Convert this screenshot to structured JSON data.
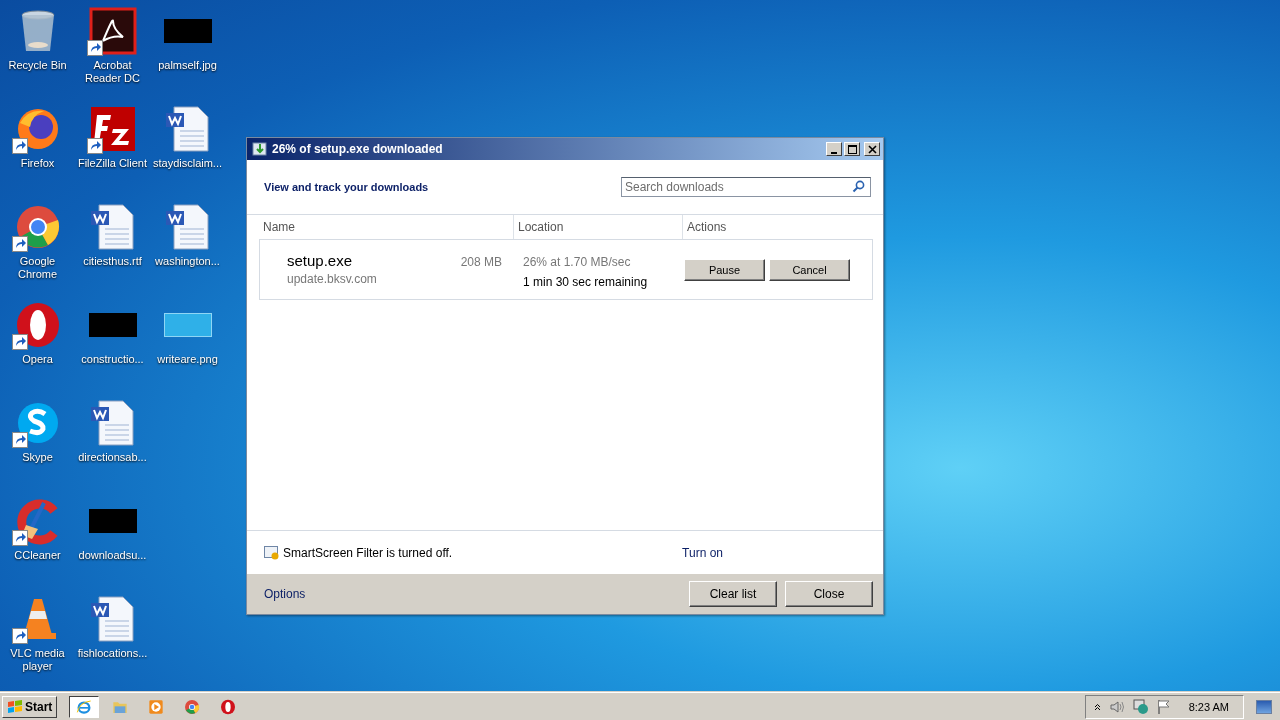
{
  "desktop_icons": [
    {
      "label": "Recycle Bin",
      "kind": "bin",
      "shortcut": false
    },
    {
      "label": "Firefox",
      "kind": "firefox",
      "shortcut": true
    },
    {
      "label": "Google Chrome",
      "kind": "chrome",
      "shortcut": true
    },
    {
      "label": "Opera",
      "kind": "opera",
      "shortcut": true
    },
    {
      "label": "Skype",
      "kind": "skype",
      "shortcut": true
    },
    {
      "label": "CCleaner",
      "kind": "ccleaner",
      "shortcut": true
    },
    {
      "label": "VLC media player",
      "kind": "vlc",
      "shortcut": true
    },
    {
      "label": "Acrobat Reader DC",
      "kind": "acrobat",
      "shortcut": true
    },
    {
      "label": "FileZilla Client",
      "kind": "filezilla",
      "shortcut": true
    },
    {
      "label": "citiesthus.rtf",
      "kind": "document",
      "shortcut": false
    },
    {
      "label": "constructio...",
      "kind": "thumbnail",
      "shortcut": false
    },
    {
      "label": "directionsab...",
      "kind": "document",
      "shortcut": false
    },
    {
      "label": "downloadsu...",
      "kind": "thumbnail",
      "shortcut": false
    },
    {
      "label": "fishlocations...",
      "kind": "document",
      "shortcut": false
    },
    {
      "label": "palmself.jpg",
      "kind": "thumbnail",
      "shortcut": false
    },
    {
      "label": "staydisclaim...",
      "kind": "document",
      "shortcut": false
    },
    {
      "label": "washington...",
      "kind": "document",
      "shortcut": false
    },
    {
      "label": "writeare.png",
      "kind": "blank",
      "shortcut": false
    }
  ],
  "window": {
    "title": "26% of setup.exe downloaded",
    "heading": "View and track your downloads",
    "search": {
      "placeholder": "Search downloads"
    },
    "columns": [
      "Name",
      "Location",
      "Actions"
    ],
    "downloads": [
      {
        "name": "setup.exe",
        "size": "208 MB",
        "source": "update.bksv.com",
        "progress": "26% at 1.70 MB/sec",
        "remaining": "1 min 30 sec remaining",
        "buttons": [
          "Pause",
          "Cancel"
        ]
      }
    ],
    "smartscreen": {
      "message": "SmartScreen Filter is turned off.",
      "link": "Turn on"
    },
    "options_link": "Options",
    "buttons": [
      "Clear list",
      "Close"
    ]
  },
  "taskbar": {
    "start": "Start",
    "apps": [
      {
        "kind": "ie",
        "selected": true
      },
      {
        "kind": "folder",
        "selected": false
      },
      {
        "kind": "media",
        "selected": false
      },
      {
        "kind": "chrome",
        "selected": false
      },
      {
        "kind": "opera",
        "selected": false
      }
    ],
    "clock": "8:23 AM"
  }
}
